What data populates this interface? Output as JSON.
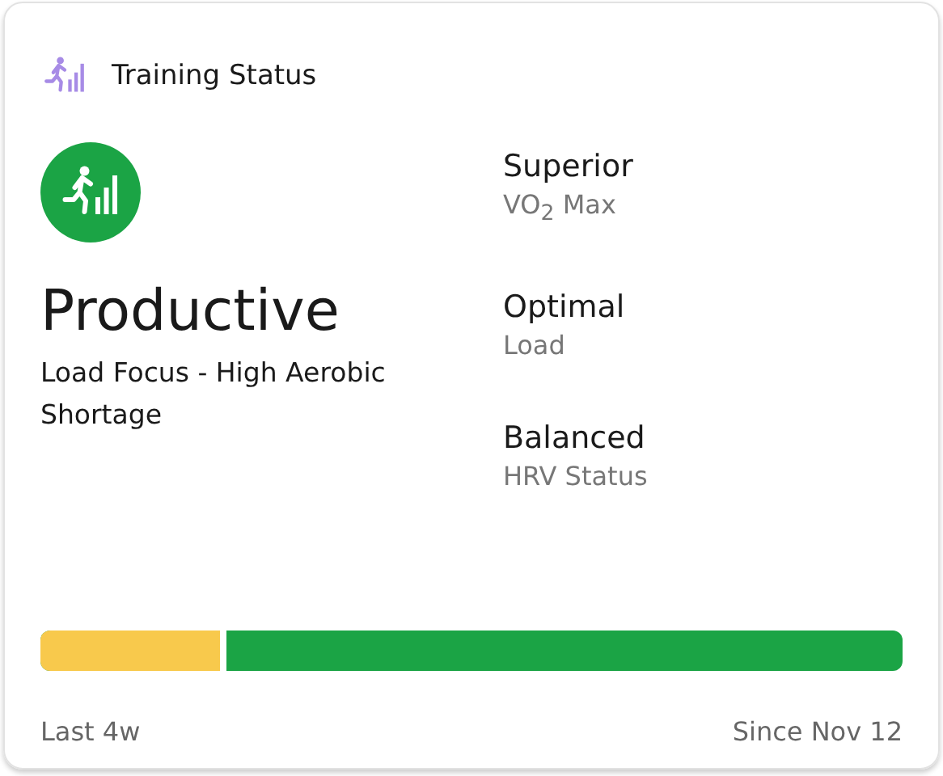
{
  "header": {
    "title": "Training Status"
  },
  "status": {
    "label": "Productive",
    "description": "Load Focus - High Aerobic Shortage",
    "color": "#1ba445"
  },
  "metrics": [
    {
      "value": "Superior",
      "label": "VO$_{2}$ Max"
    },
    {
      "value": "Optimal",
      "label": "Load"
    },
    {
      "value": "Balanced",
      "label": "HRV Status"
    }
  ],
  "bar": {
    "level": 0.215
  },
  "footer": {
    "left": "Last 4w",
    "right": "Since Nov 12"
  }
}
